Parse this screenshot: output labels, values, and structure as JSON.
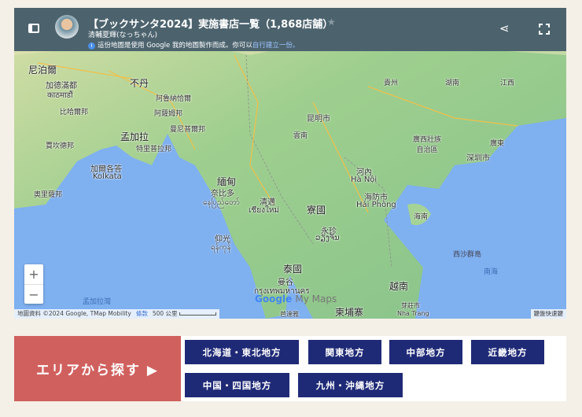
{
  "header": {
    "title": "【ブックサンタ2024】実施書店一覧（1,868店舗）",
    "author": "清輔夏輝(なっちゃん)",
    "info_text": "這份地圖是使用 Google 我的地圖製作而成。你可以",
    "info_link": "自行建立一份。"
  },
  "map": {
    "labels": {
      "nepal": "尼泊爾",
      "kathmandu": "加德滿都",
      "kathmandu_np": "काठमाडौं",
      "bihar": "比哈爾邦",
      "bhutan": "不丹",
      "arunachal": "阿魯納恰爾",
      "assam": "阿薩姆邦",
      "meghalaya": "曼尼普爾邦",
      "bangladesh": "孟加拉",
      "tripura": "特里普拉邦",
      "jharkhand": "賈坎德邦",
      "kolkata_zh": "加爾各答",
      "kolkata": "Kolkata",
      "odisha": "奧里薩邦",
      "myanmar": "緬甸",
      "naypyidaw": "奈比多",
      "naypyidaw_my": "နေပြည်တော်",
      "chiangmai": "清邁",
      "chiangmai_th": "เชียงใหม่",
      "yangon": "仰光",
      "yangon_my": "ရန်ကုန်",
      "kunming": "昆明市",
      "yunnan": "雲南",
      "guizhou": "貴州",
      "hunan": "湖南",
      "jiangxi": "江西",
      "guangxi": "廣西壯族自治區",
      "guangdong": "廣東",
      "shenzhen": "深圳市",
      "hanoi_zh": "河內",
      "hanoi": "Hà Nội",
      "haiphong_zh": "海防市",
      "haiphong": "Hải Phòng",
      "hainan": "海南",
      "laos": "寮國",
      "vientiane": "永珍",
      "vientiane_lo": "ວຽງຈັນ",
      "thailand": "泰國",
      "bangkok_zh": "曼谷",
      "bangkok": "กรุงเทพมหานคร",
      "vietnam": "越南",
      "cambodia": "柬埔寨",
      "nhatrang_zh": "芽莊市",
      "nhatrang": "Nha Trang",
      "paracel": "西沙群島",
      "scs": "南海",
      "bay": "孟加拉灣",
      "pattaya": "芭達雅"
    },
    "attribution": "地圖資料 ©2024 Google, TMap Mobility",
    "terms": "條款",
    "scale": "500 公里",
    "keyboard": "鍵盤快速鍵",
    "logo": "Google",
    "logo_suffix": "My Maps",
    "zoom_in": "+",
    "zoom_out": "−"
  },
  "area": {
    "label": "エリアから探す ▶",
    "regions": [
      "北海道・東北地方",
      "関東地方",
      "中部地方",
      "近畿地方",
      "中国・四国地方",
      "九州・沖縄地方"
    ]
  },
  "colors": {
    "header": "#4c636e",
    "area_button": "#d0605e",
    "region_button": "#1f2a77"
  }
}
